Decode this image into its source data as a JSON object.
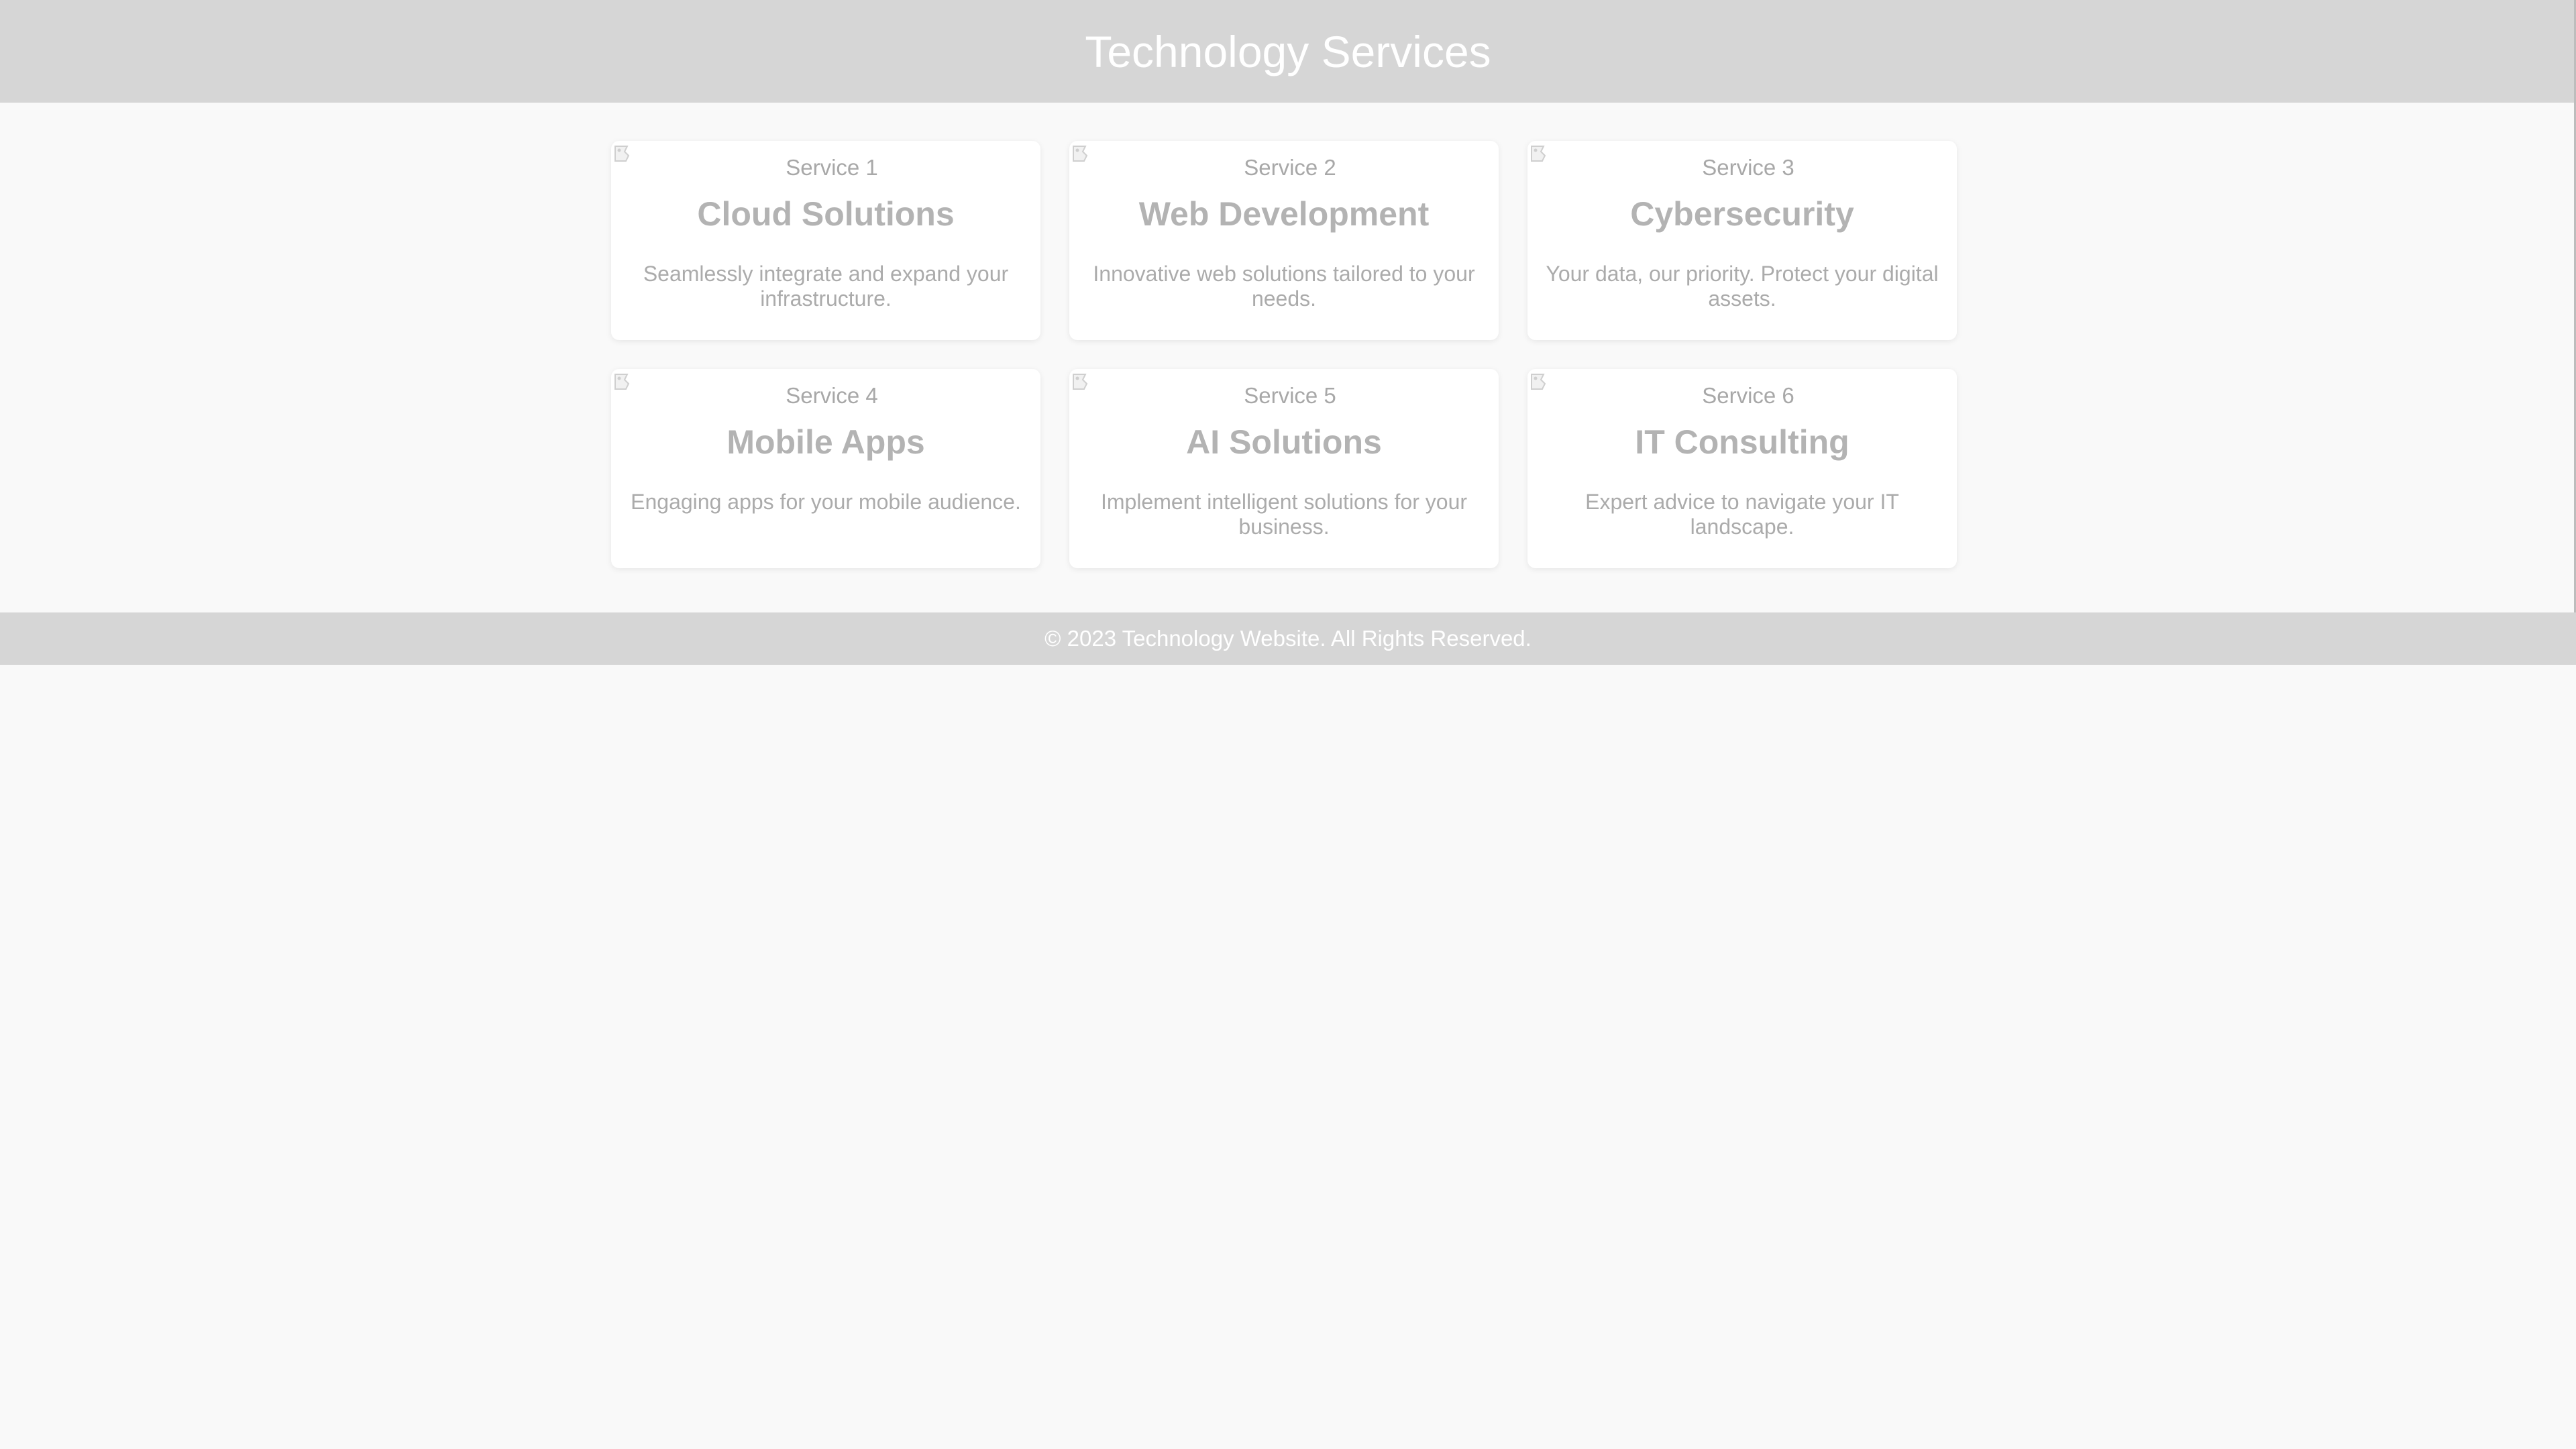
{
  "header": {
    "title": "Technology Services"
  },
  "services": [
    {
      "alt": "Service 1",
      "title": "Cloud Solutions",
      "description": "Seamlessly integrate and expand your infrastructure."
    },
    {
      "alt": "Service 2",
      "title": "Web Development",
      "description": "Innovative web solutions tailored to your needs."
    },
    {
      "alt": "Service 3",
      "title": "Cybersecurity",
      "description": "Your data, our priority. Protect your digital assets."
    },
    {
      "alt": "Service 4",
      "title": "Mobile Apps",
      "description": "Engaging apps for your mobile audience."
    },
    {
      "alt": "Service 5",
      "title": "AI Solutions",
      "description": "Implement intelligent solutions for your business."
    },
    {
      "alt": "Service 6",
      "title": "IT Consulting",
      "description": "Expert advice to navigate your IT landscape."
    }
  ],
  "footer": {
    "text": "© 2023 Technology Website. All Rights Reserved."
  },
  "icons": {
    "service_image": "broken-image-icon"
  },
  "colors": {
    "header_bg": "#d6d6d6",
    "page_bg": "#f9f9f9",
    "card_bg": "#ffffff",
    "header_text": "#ffffff",
    "card_title": "#b3b3b3",
    "card_text": "#ababab"
  }
}
